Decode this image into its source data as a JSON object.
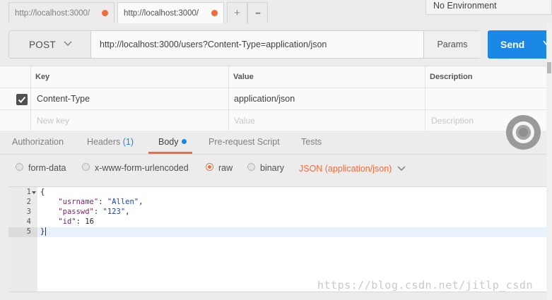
{
  "tabs": [
    {
      "label": "http://localhost:3000/",
      "unsaved": true,
      "active": false
    },
    {
      "label": "http://localhost:3000/",
      "unsaved": true,
      "active": true
    }
  ],
  "tab_actions": {
    "new_tab": "+",
    "more": "•••"
  },
  "environment": {
    "selected": "No Environment"
  },
  "request": {
    "method": "POST",
    "url": "http://localhost:3000/users?Content-Type=application/json",
    "params_label": "Params",
    "send_label": "Send"
  },
  "headers_table": {
    "columns": [
      "Key",
      "Value",
      "Description"
    ],
    "rows": [
      {
        "checked": true,
        "key": "Content-Type",
        "value": "application/json",
        "description": ""
      }
    ],
    "new_row": {
      "key_placeholder": "New key",
      "value_placeholder": "Value",
      "description_placeholder": "Description"
    }
  },
  "request_tabs": {
    "authorization": "Authorization",
    "headers": "Headers",
    "headers_count": "(1)",
    "body": "Body",
    "prerequest": "Pre-request Script",
    "tests": "Tests",
    "active": "Body"
  },
  "body_options": {
    "form_data": "form-data",
    "urlencoded": "x-www-form-urlencoded",
    "raw": "raw",
    "binary": "binary",
    "selected": "raw",
    "content_type": "JSON (application/json)"
  },
  "editor": {
    "line_numbers": [
      "1",
      "2",
      "3",
      "4",
      "5"
    ],
    "lines": {
      "l1": "{",
      "l2_key": "\"usrname\"",
      "l2_val": "\"Allen\"",
      "l3_key": "\"passwd\"",
      "l3_val": "\"123\"",
      "l4_key": "\"id\"",
      "l4_val": "16",
      "l5": "}"
    }
  },
  "watermark": "https://blog.csdn.net/jitlp_csdn",
  "colors": {
    "accent": "#f26b3a",
    "send": "#1b87e6"
  }
}
